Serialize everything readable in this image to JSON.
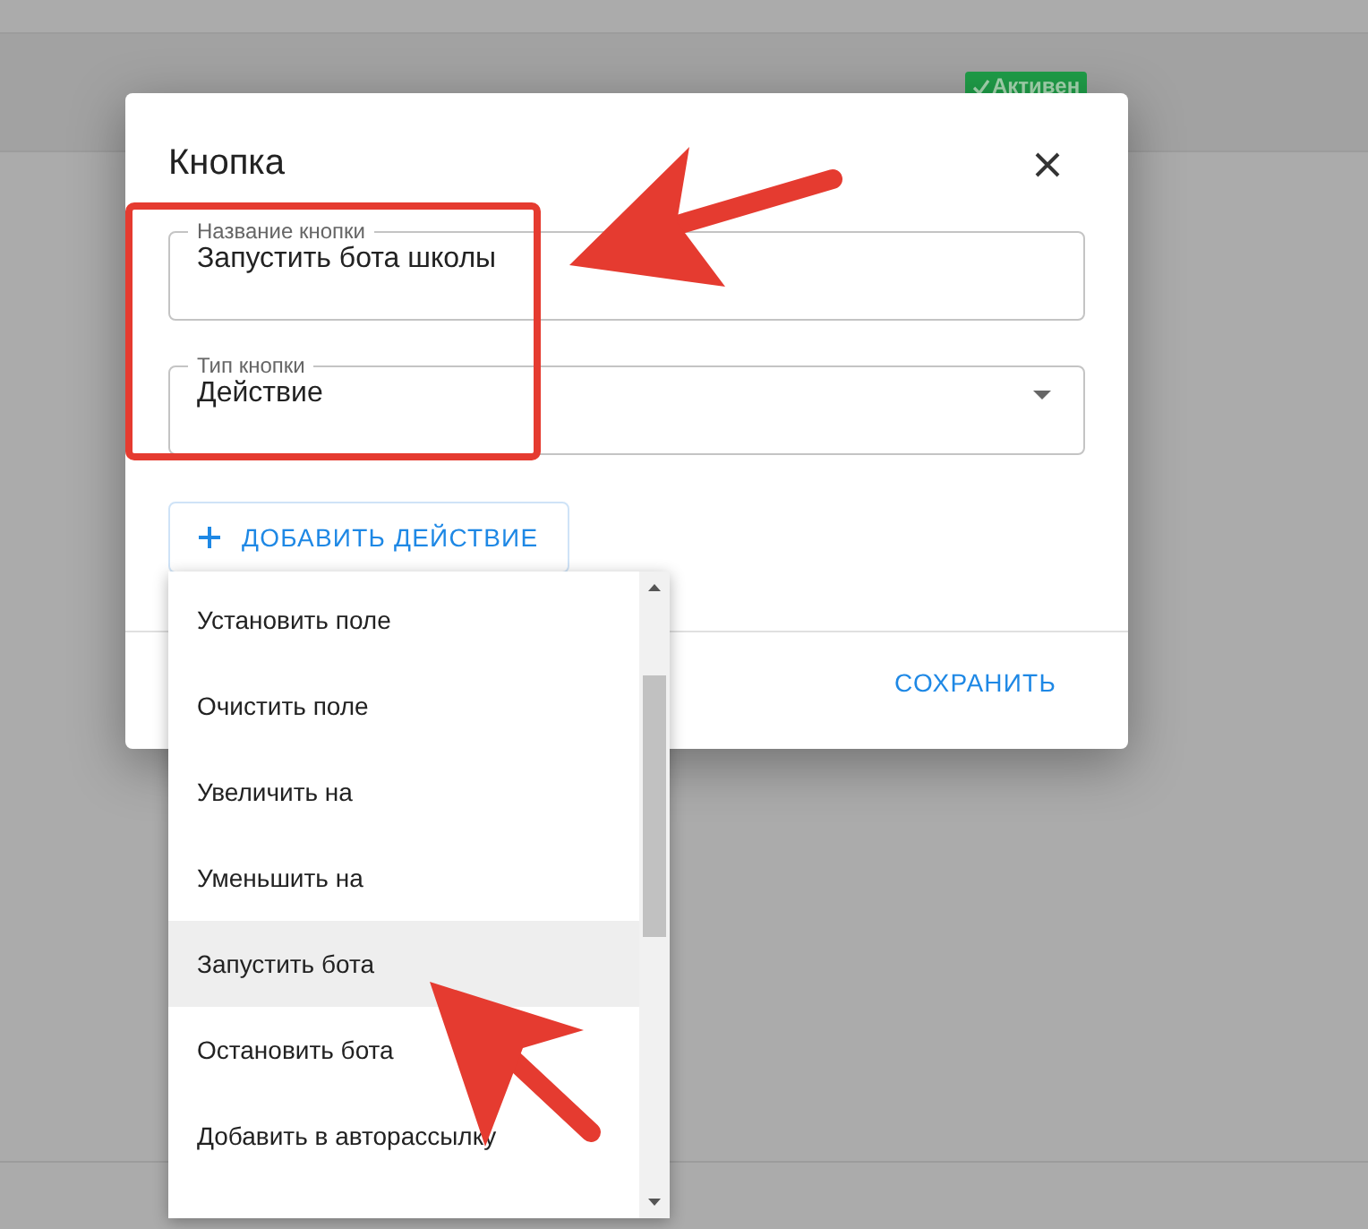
{
  "background_table": {
    "rows": [
      {
        "status": "Активен"
      }
    ]
  },
  "dialog": {
    "title": "Кнопка",
    "fields": [
      {
        "kind": "text",
        "label": "Название кнопки",
        "value": "Запустить бота школы"
      },
      {
        "kind": "select",
        "label": "Тип кнопки",
        "value": "Действие"
      }
    ],
    "add_button": "ДОБАВИТЬ ДЕЙСТВИЕ",
    "save_button": "СОХРАНИТЬ"
  },
  "action_menu": {
    "items": [
      {
        "label": "Установить поле",
        "selected": false
      },
      {
        "label": "Очистить поле",
        "selected": false
      },
      {
        "label": "Увеличить на",
        "selected": false
      },
      {
        "label": "Уменьшить на",
        "selected": false
      },
      {
        "label": "Запустить бота",
        "selected": true
      },
      {
        "label": "Остановить бота",
        "selected": false
      },
      {
        "label": "Добавить в авторассылку",
        "selected": false
      }
    ]
  }
}
